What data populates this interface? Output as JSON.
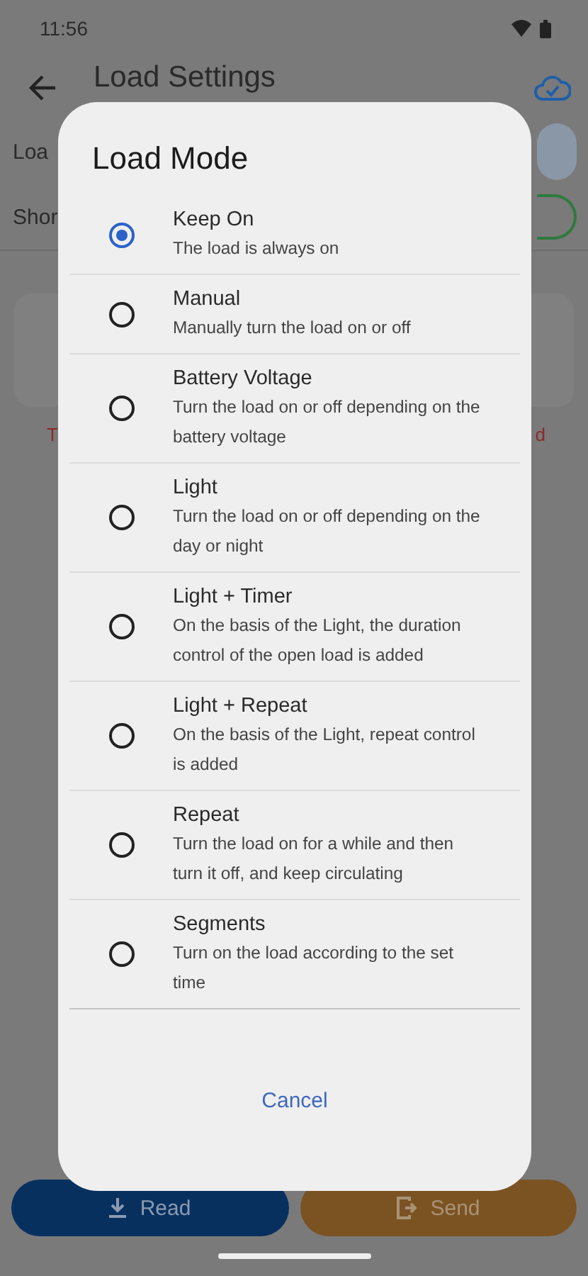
{
  "status_bar": {
    "time": "11:56"
  },
  "app_bar": {
    "title": "Load Settings"
  },
  "background": {
    "row_labels": [
      "Loa",
      "Shor"
    ],
    "switch_on": true,
    "warning_left": "T",
    "warning_right": "d"
  },
  "dialog": {
    "title": "Load Mode",
    "options": [
      {
        "label": "Keep On",
        "description": "The load is always on",
        "selected": true
      },
      {
        "label": "Manual",
        "description": "Manually turn the load on or off",
        "selected": false
      },
      {
        "label": "Battery Voltage",
        "description": "Turn the load on or off depending on the battery voltage",
        "selected": false
      },
      {
        "label": "Light",
        "description": "Turn the load on or off depending on the day or night",
        "selected": false
      },
      {
        "label": "Light + Timer",
        "description": "On the basis of the Light, the duration control of the open load is added",
        "selected": false
      },
      {
        "label": "Light + Repeat",
        "description": "On the basis of the Light, repeat control is added",
        "selected": false
      },
      {
        "label": "Repeat",
        "description": "Turn the load on for a while and then turn it off, and keep circulating",
        "selected": false
      },
      {
        "label": "Segments",
        "description": "Turn on the load according to the set time",
        "selected": false
      }
    ],
    "cancel": "Cancel"
  },
  "buttons": [
    {
      "label": "Read",
      "kind": "read"
    },
    {
      "label": "Send",
      "kind": "send"
    }
  ]
}
